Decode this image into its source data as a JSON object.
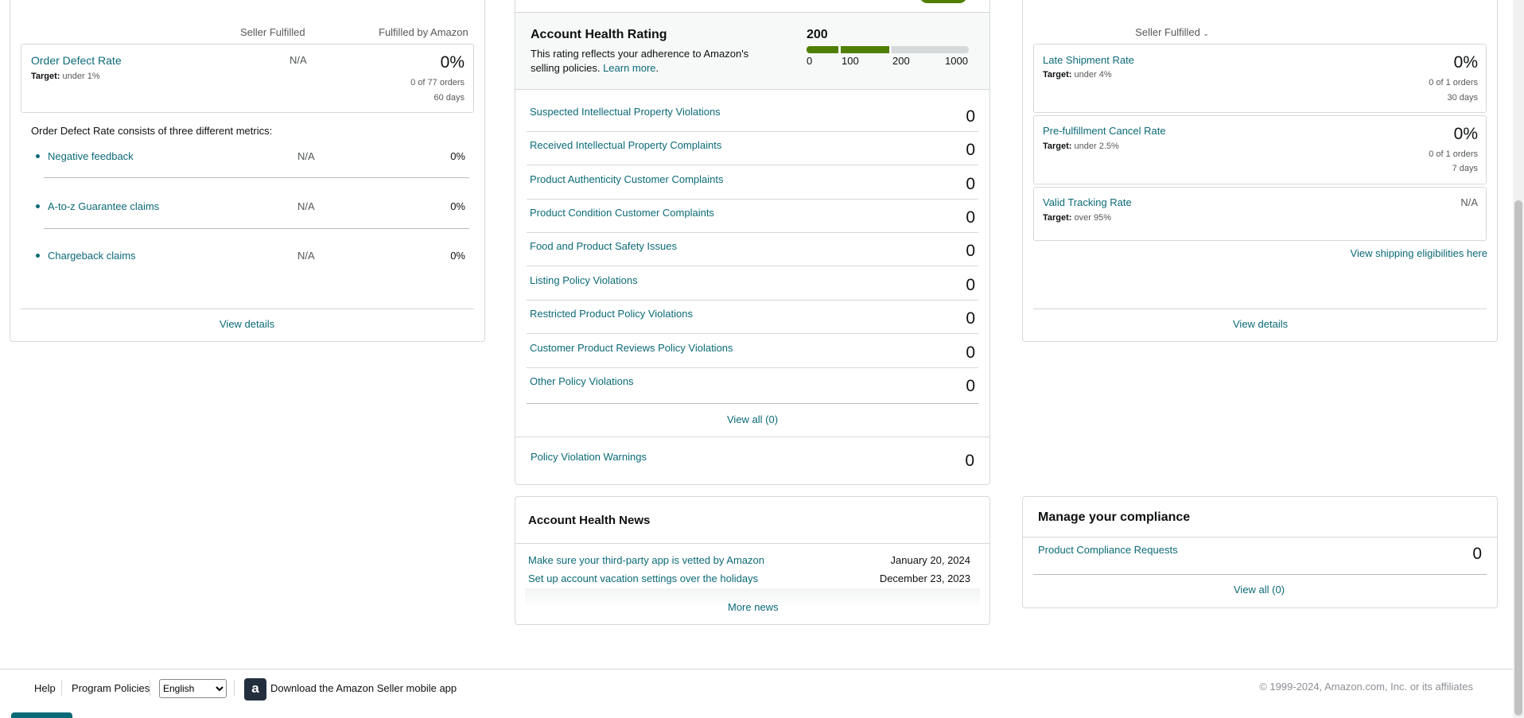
{
  "left_panel": {
    "col_seller": "Seller Fulfilled",
    "col_amazon": "Fulfilled by Amazon",
    "odr": {
      "title": "Order Defect Rate",
      "target_label": "Target:",
      "target_value": "under 1%",
      "seller_value": "N/A",
      "amazon_value": "0%",
      "orders": "0 of 77 orders",
      "period": "60 days"
    },
    "consists_text": "Order Defect Rate consists of three different metrics:",
    "metrics": [
      {
        "label": "Negative feedback",
        "seller": "N/A",
        "amazon": "0%"
      },
      {
        "label": "A-to-z Guarantee claims",
        "seller": "N/A",
        "amazon": "0%"
      },
      {
        "label": "Chargeback claims",
        "seller": "N/A",
        "amazon": "0%"
      }
    ],
    "view_details": "View details"
  },
  "health_rating": {
    "title": "Account Health Rating",
    "score": "200",
    "desc": "This rating reflects your adherence to Amazon's selling policies.",
    "learn_more": "Learn more",
    "scale_labels": [
      "0",
      "100",
      "200",
      "1000"
    ],
    "violations": [
      {
        "label": "Suspected Intellectual Property Violations",
        "value": "0"
      },
      {
        "label": "Received Intellectual Property Complaints",
        "value": "0"
      },
      {
        "label": "Product Authenticity Customer Complaints",
        "value": "0"
      },
      {
        "label": "Product Condition Customer Complaints",
        "value": "0"
      },
      {
        "label": "Food and Product Safety Issues",
        "value": "0"
      },
      {
        "label": "Listing Policy Violations",
        "value": "0"
      },
      {
        "label": "Restricted Product Policy Violations",
        "value": "0"
      },
      {
        "label": "Customer Product Reviews Policy Violations",
        "value": "0"
      },
      {
        "label": "Other Policy Violations",
        "value": "0"
      }
    ],
    "view_all": "View all (0)",
    "warnings_label": "Policy Violation Warnings",
    "warnings_value": "0",
    "colors": {
      "bar_fill": "#507f00",
      "bar_empty": "#d5d9d9"
    }
  },
  "news": {
    "title": "Account Health News",
    "items": [
      {
        "label": "Make sure your third-party app is vetted by Amazon",
        "date": "January 20, 2024"
      },
      {
        "label": "Set up account vacation settings over the holidays",
        "date": "December 23, 2023"
      }
    ],
    "more": "More news"
  },
  "shipping": {
    "dropdown": "Seller Fulfilled",
    "metrics": [
      {
        "title": "Late Shipment Rate",
        "target": "under 4%",
        "value": "0%",
        "orders": "0 of 1 orders",
        "period": "30 days"
      },
      {
        "title": "Pre-fulfillment Cancel Rate",
        "target": "under 2.5%",
        "value": "0%",
        "orders": "0 of 1 orders",
        "period": "7 days"
      },
      {
        "title": "Valid Tracking Rate",
        "target": "over 95%",
        "value": "N/A"
      }
    ],
    "target_label": "Target:",
    "eligibility_link": "View shipping eligibilities here",
    "view_details": "View details"
  },
  "compliance": {
    "title": "Manage your compliance",
    "item_label": "Product Compliance Requests",
    "item_value": "0",
    "view_all": "View all (0)"
  },
  "footer": {
    "help": "Help",
    "program_policies": "Program Policies",
    "language": "English",
    "app_text": "Download the Amazon Seller mobile app",
    "copyright": "© 1999-2024, Amazon.com, Inc. or its affiliates"
  }
}
